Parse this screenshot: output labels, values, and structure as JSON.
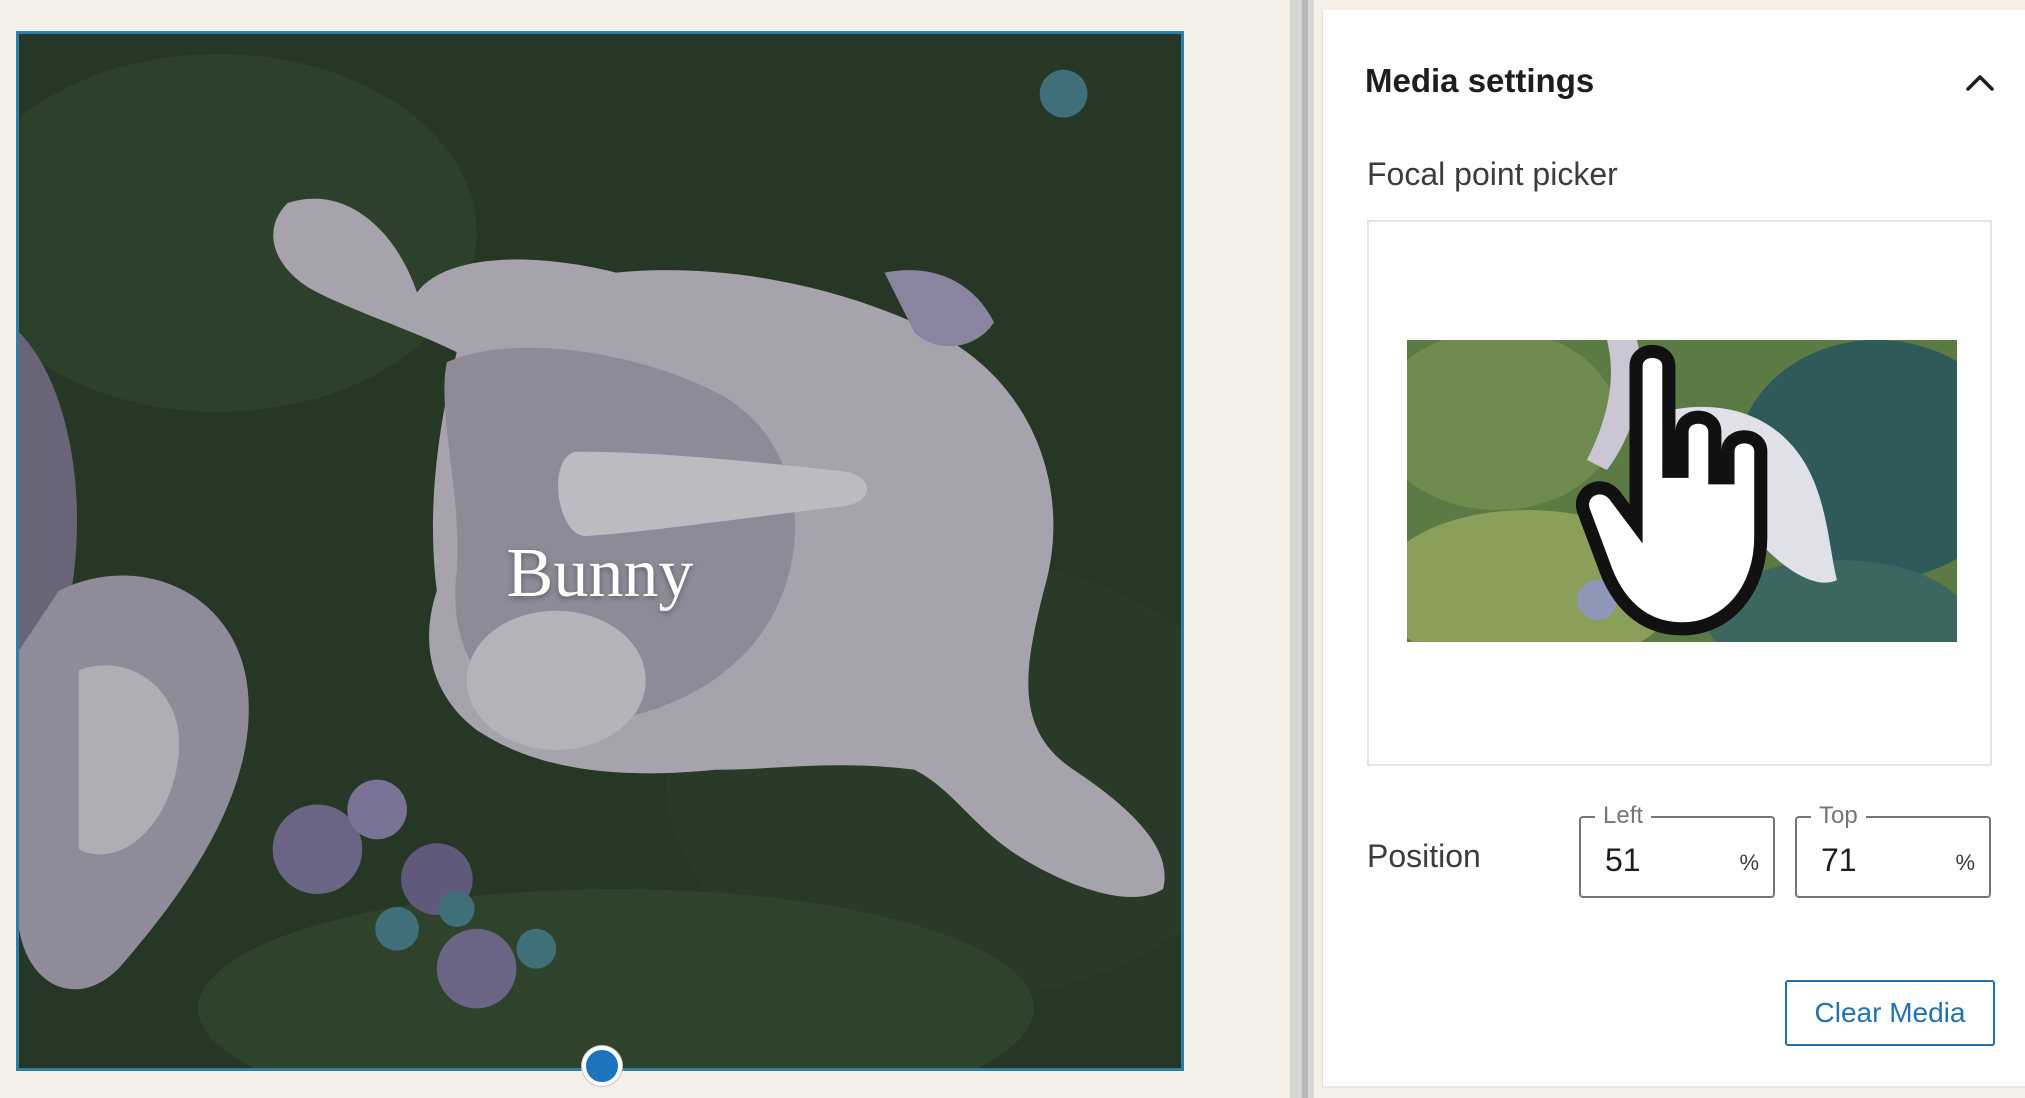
{
  "canvas": {
    "cover_title": "Bunny"
  },
  "sidebar": {
    "panel_title": "Media settings",
    "focal_point_label": "Focal point picker",
    "position_label": "Position",
    "left_field": {
      "legend": "Left",
      "value": "51",
      "suffix": "%"
    },
    "top_field": {
      "legend": "Top",
      "value": "71",
      "suffix": "%"
    },
    "clear_button": "Clear Media"
  },
  "icons": {
    "panel_toggle": "chevron-up-icon",
    "cursor": "hand-pointer-icon"
  },
  "colors": {
    "accent": "#2271b1",
    "selection_border": "#2c7fa6",
    "resize_handle": "#1e73be",
    "focal_marker": "#0d6e8a",
    "canvas_background": "#f4efe7"
  }
}
